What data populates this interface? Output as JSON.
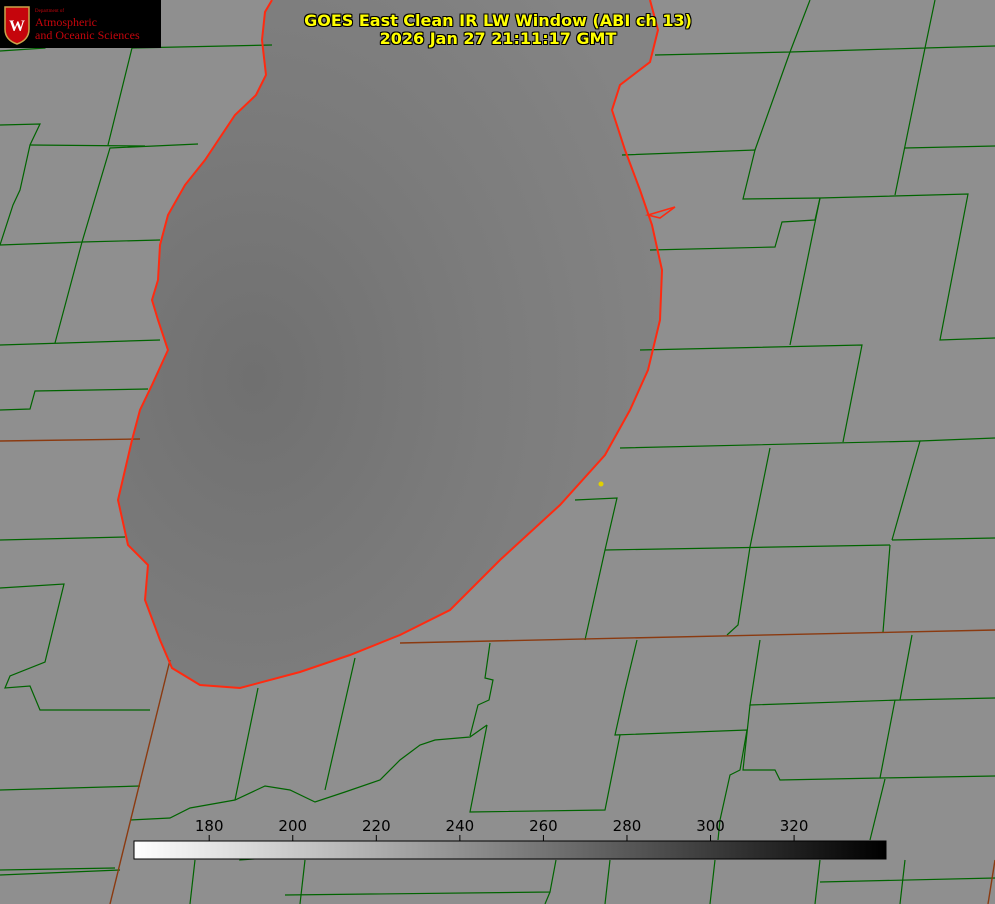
{
  "header": {
    "title": "GOES East Clean IR LW Window (ABI ch 13)",
    "timestamp": "2026 Jan 27 21:11:17 GMT"
  },
  "logo": {
    "department_line": "Department of",
    "name_line1": "Atmospheric",
    "name_line2": "and Oceanic Sciences",
    "seal_letter": "W"
  },
  "colorbar": {
    "ticks": [
      "180",
      "200",
      "220",
      "240",
      "260",
      "280",
      "300",
      "320"
    ],
    "range": [
      162,
      342
    ],
    "gradient": "white-to-black"
  },
  "map": {
    "lake_color": "#7f7f7f",
    "land_color": "#8f8f8f",
    "county_line_color": "#006400",
    "state_line_color": "#8b3a10",
    "coastline_color": "#ff2a10",
    "marker_color": "#e0d000"
  }
}
